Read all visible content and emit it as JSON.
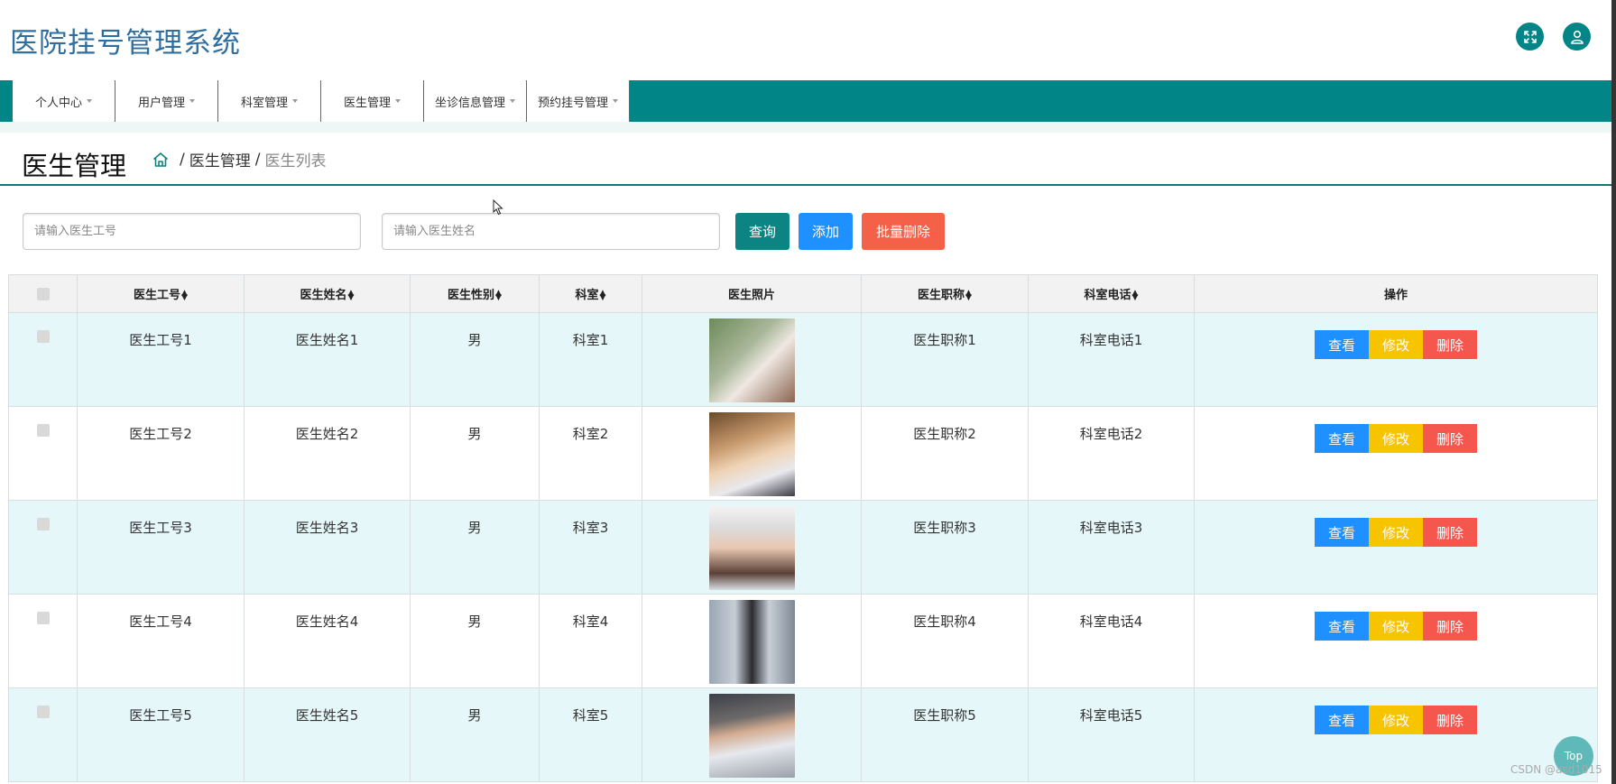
{
  "app": {
    "title": "医院挂号管理系统"
  },
  "header_icons": {
    "fullscreen": "fullscreen-icon",
    "user": "user-icon"
  },
  "nav": {
    "items": [
      {
        "label": "个人中心"
      },
      {
        "label": "用户管理"
      },
      {
        "label": "科室管理"
      },
      {
        "label": "医生管理"
      },
      {
        "label": "坐诊信息管理"
      },
      {
        "label": "预约挂号管理"
      }
    ]
  },
  "page": {
    "title": "医生管理",
    "breadcrumb": {
      "section": "医生管理",
      "current": "医生列表",
      "separator": "/"
    }
  },
  "search": {
    "id_placeholder": "请输入医生工号",
    "name_placeholder": "请输入医生姓名",
    "query_label": "查询",
    "add_label": "添加",
    "batch_delete_label": "批量删除"
  },
  "table": {
    "headers": {
      "doctor_id": "医生工号",
      "doctor_name": "医生姓名",
      "gender": "医生性别",
      "dept": "科室",
      "photo": "医生照片",
      "doctor_title": "医生职称",
      "dept_phone": "科室电话",
      "actions": "操作"
    },
    "rows": [
      {
        "doctor_id": "医生工号1",
        "doctor_name": "医生姓名1",
        "gender": "男",
        "dept": "科室1",
        "doctor_title": "医生职称1",
        "dept_phone": "科室电话1"
      },
      {
        "doctor_id": "医生工号2",
        "doctor_name": "医生姓名2",
        "gender": "男",
        "dept": "科室2",
        "doctor_title": "医生职称2",
        "dept_phone": "科室电话2"
      },
      {
        "doctor_id": "医生工号3",
        "doctor_name": "医生姓名3",
        "gender": "男",
        "dept": "科室3",
        "doctor_title": "医生职称3",
        "dept_phone": "科室电话3"
      },
      {
        "doctor_id": "医生工号4",
        "doctor_name": "医生姓名4",
        "gender": "男",
        "dept": "科室4",
        "doctor_title": "医生职称4",
        "dept_phone": "科室电话4"
      },
      {
        "doctor_id": "医生工号5",
        "doctor_name": "医生姓名5",
        "gender": "男",
        "dept": "科室5",
        "doctor_title": "医生职称5",
        "dept_phone": "科室电话5"
      }
    ],
    "actions": {
      "view": "查看",
      "edit": "修改",
      "delete": "删除"
    }
  },
  "footer": {
    "top_label": "Top",
    "watermark": "CSDN @asd1015"
  },
  "colors": {
    "brand_teal": "#028586",
    "title_blue": "#2f6f9f",
    "button_blue": "#1e90ff",
    "button_yellow": "#f7c400",
    "button_red": "#f5574f",
    "row_highlight": "#e6f7fa"
  }
}
